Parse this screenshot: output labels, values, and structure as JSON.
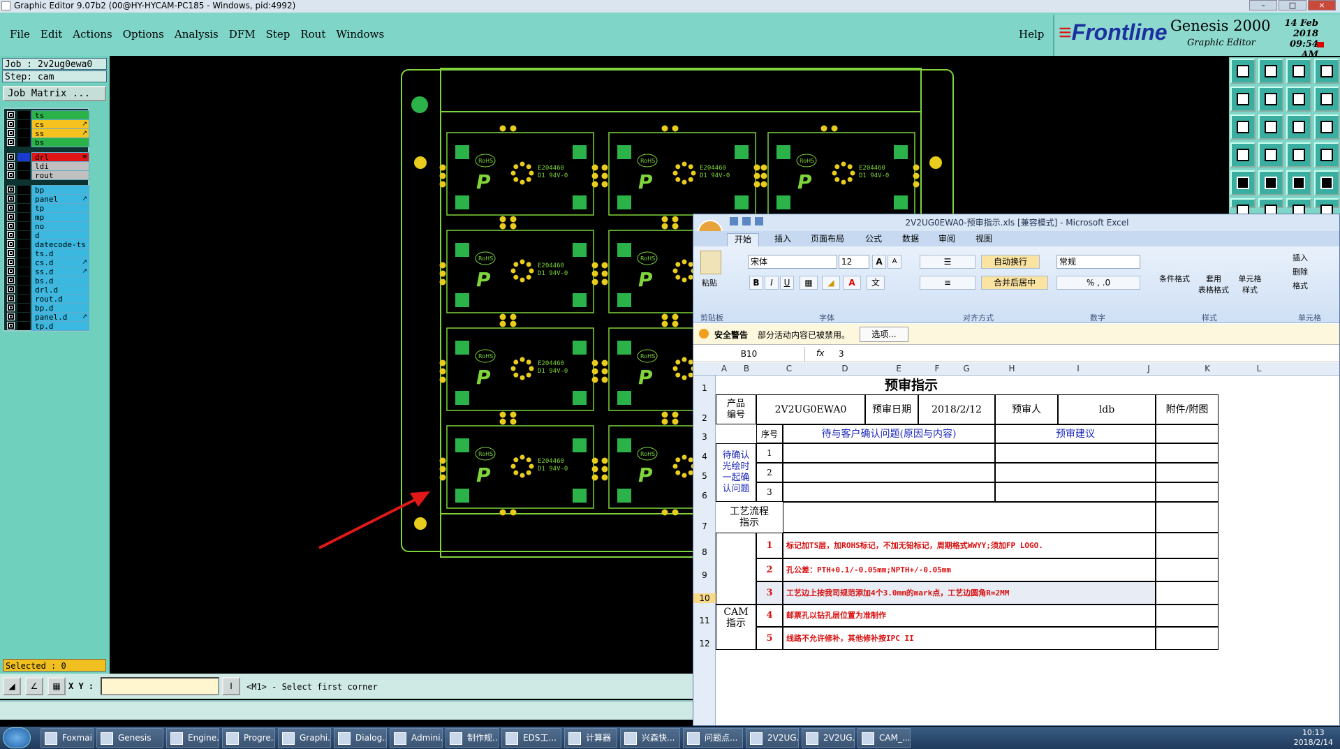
{
  "window": {
    "title": "Graphic Editor 9.07b2 (00@HY-HYCAM-PC185 - Windows, pid:4992)"
  },
  "menu": {
    "items": [
      "File",
      "Edit",
      "Actions",
      "Options",
      "Analysis",
      "DFM",
      "Step",
      "Rout",
      "Windows"
    ],
    "help": "Help"
  },
  "brand": {
    "logo_main": "Frontline",
    "product": "Genesis 2000",
    "subtitle": "Graphic Editor",
    "date": "14 Feb 2018",
    "time": "09:54 AM"
  },
  "job": {
    "job_label": "Job : 2v2ug0ewa0",
    "step_label": "Step: cam",
    "matrix_button": "Job Matrix ..."
  },
  "layers": [
    {
      "name": "ts",
      "color": "#2bb34a",
      "flag": ""
    },
    {
      "name": "cs",
      "color": "#f6c21d",
      "flag": "↗"
    },
    {
      "name": "ss",
      "color": "#f6c21d",
      "flag": "↗"
    },
    {
      "name": "bs",
      "color": "#2bb34a",
      "flag": ""
    },
    {
      "name": "drl",
      "color": "#e01515",
      "flag": "≡",
      "active": true
    },
    {
      "name": "ldi",
      "color": "#c0c0c0",
      "flag": ""
    },
    {
      "name": "rout",
      "color": "#c0c0c0",
      "flag": ""
    },
    {
      "name": "bp",
      "color": "#3ab8e0",
      "flag": ""
    },
    {
      "name": "panel",
      "color": "#3ab8e0",
      "flag": "↗"
    },
    {
      "name": "tp",
      "color": "#3ab8e0",
      "flag": ""
    },
    {
      "name": "mp",
      "color": "#3ab8e0",
      "flag": ""
    },
    {
      "name": "no",
      "color": "#3ab8e0",
      "flag": ""
    },
    {
      "name": "d",
      "color": "#3ab8e0",
      "flag": ""
    },
    {
      "name": "datecode-ts",
      "color": "#3ab8e0",
      "flag": ""
    },
    {
      "name": "ts.d",
      "color": "#3ab8e0",
      "flag": ""
    },
    {
      "name": "cs.d",
      "color": "#3ab8e0",
      "flag": "↗"
    },
    {
      "name": "ss.d",
      "color": "#3ab8e0",
      "flag": "↗"
    },
    {
      "name": "bs.d",
      "color": "#3ab8e0",
      "flag": ""
    },
    {
      "name": "drl.d",
      "color": "#3ab8e0",
      "flag": ""
    },
    {
      "name": "rout.d",
      "color": "#3ab8e0",
      "flag": ""
    },
    {
      "name": "bp.d",
      "color": "#3ab8e0",
      "flag": ""
    },
    {
      "name": "panel.d",
      "color": "#3ab8e0",
      "flag": "↗"
    },
    {
      "name": "tp.d",
      "color": "#3ab8e0",
      "flag": ""
    }
  ],
  "status": {
    "selected": "Selected : 0",
    "xy_label": "X Y :",
    "xy_value": "",
    "prompt": "<M1> - Select first corner"
  },
  "pcb": {
    "rohs": "RoHS",
    "marking1": "E204460",
    "marking2": "D1  94V-0"
  },
  "excel": {
    "title": "2V2UG0EWA0-预审指示.xls  [兼容模式] - Microsoft Excel",
    "tabs": [
      "开始",
      "插入",
      "页面布局",
      "公式",
      "数据",
      "审阅",
      "视图"
    ],
    "ribbon": {
      "paste": "粘贴",
      "clipboard": "剪贴板",
      "font_name": "宋体",
      "font_size": "12",
      "font_group": "字体",
      "wrap": "自动换行",
      "merge": "合并后居中",
      "align_group": "对齐方式",
      "number_format": "常规",
      "number_group": "数字",
      "cond_format": "条件格式",
      "table_format": "套用\n表格格式",
      "cell_style": "单元格\n样式",
      "style_group": "样式",
      "insert": "插入",
      "delete": "删除",
      "format": "格式",
      "cells_group": "单元格"
    },
    "security": {
      "label": "安全警告",
      "message": "部分活动内容已被禁用。",
      "options": "选项..."
    },
    "namebox": "B10",
    "formula": "3",
    "columns": [
      "A",
      "B",
      "C",
      "D",
      "E",
      "F",
      "G",
      "H",
      "I",
      "J",
      "K",
      "L"
    ],
    "rows": [
      "1",
      "2",
      "3",
      "4",
      "5",
      "6",
      "7",
      "8",
      "9",
      "10",
      "11",
      "12"
    ],
    "sheet": {
      "heading": "预审指示",
      "product_no_label": "产品\n编号",
      "product_no": "2V2UG0EWA0",
      "review_date_label": "预审日期",
      "review_date": "2018/2/12",
      "reviewer_label": "预审人",
      "reviewer": "ldb",
      "attachment_label": "附件/附图",
      "seq_label": "序号",
      "issue_label": "待与客户确认问题(原因与内容)",
      "advice_label": "预审建议",
      "pending_label": "待确认\n光绘时\n一起确\n认问题",
      "pending_nums": [
        "1",
        "2",
        "3"
      ],
      "process_label": "工艺流程\n指示",
      "cam_label": "CAM\n指示",
      "steps": [
        {
          "n": "1",
          "text": "标记加TS层，加ROHS标记，不加无铅标记，周期格式WWYY;须加FP LOGO."
        },
        {
          "n": "2",
          "text": "孔公差：PTH+0.1/-0.05mm;NPTH+/-0.05mm"
        },
        {
          "n": "3",
          "text": "工艺边上按我司规范添加4个3.0mm的mark点，工艺边圆角R=2MM"
        },
        {
          "n": "4",
          "text": "邮票孔以钻孔层位置为准制作"
        },
        {
          "n": "5",
          "text": "线路不允许修补，其他修补按IPC II"
        }
      ]
    }
  },
  "taskbar": {
    "items": [
      "Foxmail",
      "Genesis",
      "Engine...",
      "Progre...",
      "Graphi...",
      "Dialog...",
      "Admini...",
      "制作规...",
      "EDS工...",
      "计算器",
      "兴森快...",
      "问题点...",
      "2V2UG...",
      "2V2UG...",
      "CAM_..."
    ],
    "time": "10:13",
    "date": "2018/2/14"
  },
  "colors": {
    "cad_bg": "#000000",
    "panel_bg": "#6fd0bd",
    "menubar_bg": "#7fd6c8",
    "board_line": "#7fd43a",
    "pad": "#e8cc1e",
    "arrow": "#e01818"
  }
}
